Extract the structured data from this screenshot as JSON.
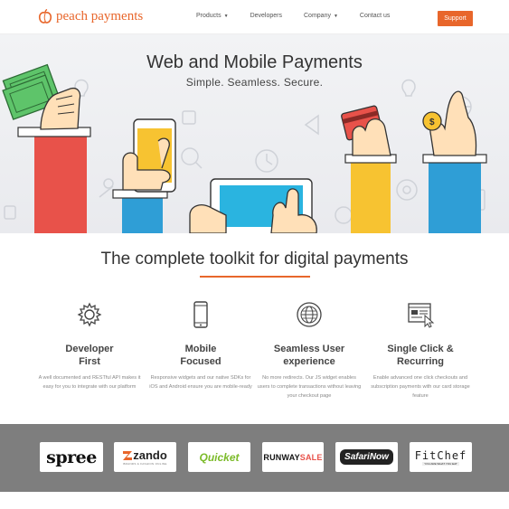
{
  "brand": {
    "name": "peach payments",
    "accent": "#e8662b"
  },
  "nav": {
    "items": [
      {
        "label": "Products",
        "dropdown": true
      },
      {
        "label": "Developers",
        "dropdown": false
      },
      {
        "label": "Company",
        "dropdown": true
      },
      {
        "label": "Contact us",
        "dropdown": false
      }
    ],
    "support_label": "Support"
  },
  "hero": {
    "title": "Web and Mobile Payments",
    "subtitle": "Simple. Seamless. Secure."
  },
  "toolkit": {
    "title": "The complete toolkit for digital payments",
    "features": [
      {
        "icon": "gear-icon",
        "title_line1": "Developer",
        "title_line2": "First",
        "text": "A well documented and RESTful API makes it easy for you to integrate with our platform"
      },
      {
        "icon": "mobile-icon",
        "title_line1": "Mobile",
        "title_line2": "Focused",
        "text": "Responsive widgets and our native SDKs for iOS and Android ensure you are mobile-ready"
      },
      {
        "icon": "globe-icon",
        "title_line1": "Seamless User",
        "title_line2": "experience",
        "text": "No more redirects. Our JS widget enables users to complete transactions without leaving your checkout page"
      },
      {
        "icon": "browser-click-icon",
        "title_line1": "Single Click &",
        "title_line2": "Recurring",
        "text": "Enable advanced one click checkouts and subscription payments with our card storage feature"
      }
    ]
  },
  "clients": [
    {
      "name": "spree"
    },
    {
      "name": "zando",
      "tagline": "BRANDS & FASHION ONLINE"
    },
    {
      "name": "Quicket"
    },
    {
      "name": "RUNWAYSALE",
      "name_part1": "RUNWAY",
      "name_part2": "SALE"
    },
    {
      "name": "SafariNow"
    },
    {
      "name": "FitChef",
      "tagline": "YOU ARE WHAT YOU EAT"
    }
  ]
}
